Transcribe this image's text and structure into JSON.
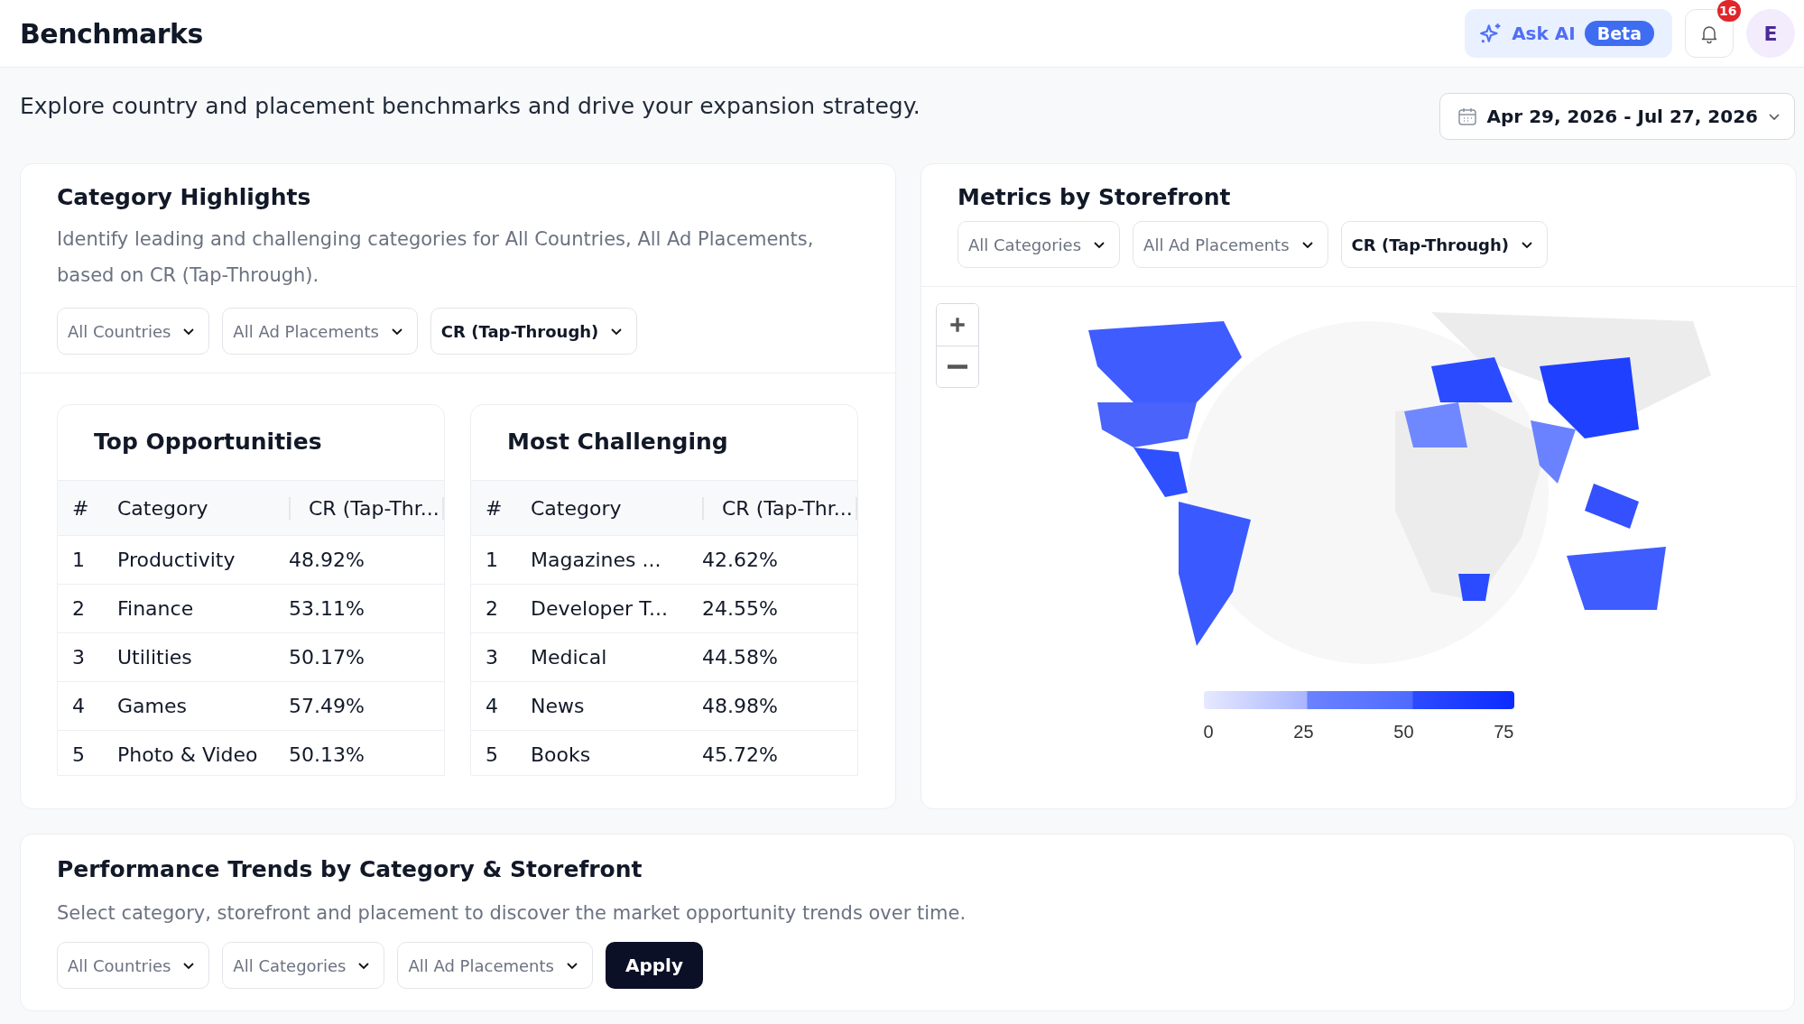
{
  "header": {
    "title": "Benchmarks",
    "ask_ai": {
      "label": "Ask AI",
      "badge": "Beta"
    },
    "notifications": {
      "count": "16"
    },
    "avatar": {
      "initial": "E"
    }
  },
  "intro": "Explore country and placement benchmarks and drive your expansion strategy.",
  "date_range": "Apr 29, 2026 - Jul 27, 2026",
  "category_highlights": {
    "title": "Category Highlights",
    "description": "Identify leading and challenging categories for All Countries, All Ad Placements, based on CR (Tap-Through).",
    "filters": [
      {
        "label": "All Countries",
        "chosen": false
      },
      {
        "label": "All Ad Placements",
        "chosen": false
      },
      {
        "label": "CR (Tap-Through)",
        "chosen": true
      }
    ],
    "tables": [
      {
        "title": "Top Opportunities",
        "columns": [
          "#",
          "Category",
          "CR (Tap-Thr..."
        ],
        "rows": [
          [
            "1",
            "Productivity",
            "48.92%"
          ],
          [
            "2",
            "Finance",
            "53.11%"
          ],
          [
            "3",
            "Utilities",
            "50.17%"
          ],
          [
            "4",
            "Games",
            "57.49%"
          ],
          [
            "5",
            "Photo & Video",
            "50.13%"
          ]
        ]
      },
      {
        "title": "Most Challenging",
        "columns": [
          "#",
          "Category",
          "CR (Tap-Thr..."
        ],
        "rows": [
          [
            "1",
            "Magazines ...",
            "42.62%"
          ],
          [
            "2",
            "Developer T...",
            "24.55%"
          ],
          [
            "3",
            "Medical",
            "44.58%"
          ],
          [
            "4",
            "News",
            "48.98%"
          ],
          [
            "5",
            "Books",
            "45.72%"
          ]
        ]
      }
    ]
  },
  "metrics_by_storefront": {
    "title": "Metrics by Storefront",
    "filters": [
      {
        "label": "All Categories",
        "chosen": false
      },
      {
        "label": "All Ad Placements",
        "chosen": false
      },
      {
        "label": "CR (Tap-Through)",
        "chosen": true
      }
    ],
    "map": {
      "kind": "picture",
      "legend_ticks": [
        "0",
        "25",
        "50",
        "75"
      ]
    }
  },
  "performance_trends": {
    "title": "Performance Trends by Category & Storefront",
    "description": "Select category, storefront and placement to discover the market opportunity trends over time.",
    "filters": [
      {
        "label": "All Countries",
        "chosen": false
      },
      {
        "label": "All Categories",
        "chosen": false
      },
      {
        "label": "All Ad Placements",
        "chosen": false
      }
    ],
    "apply": "Apply"
  }
}
